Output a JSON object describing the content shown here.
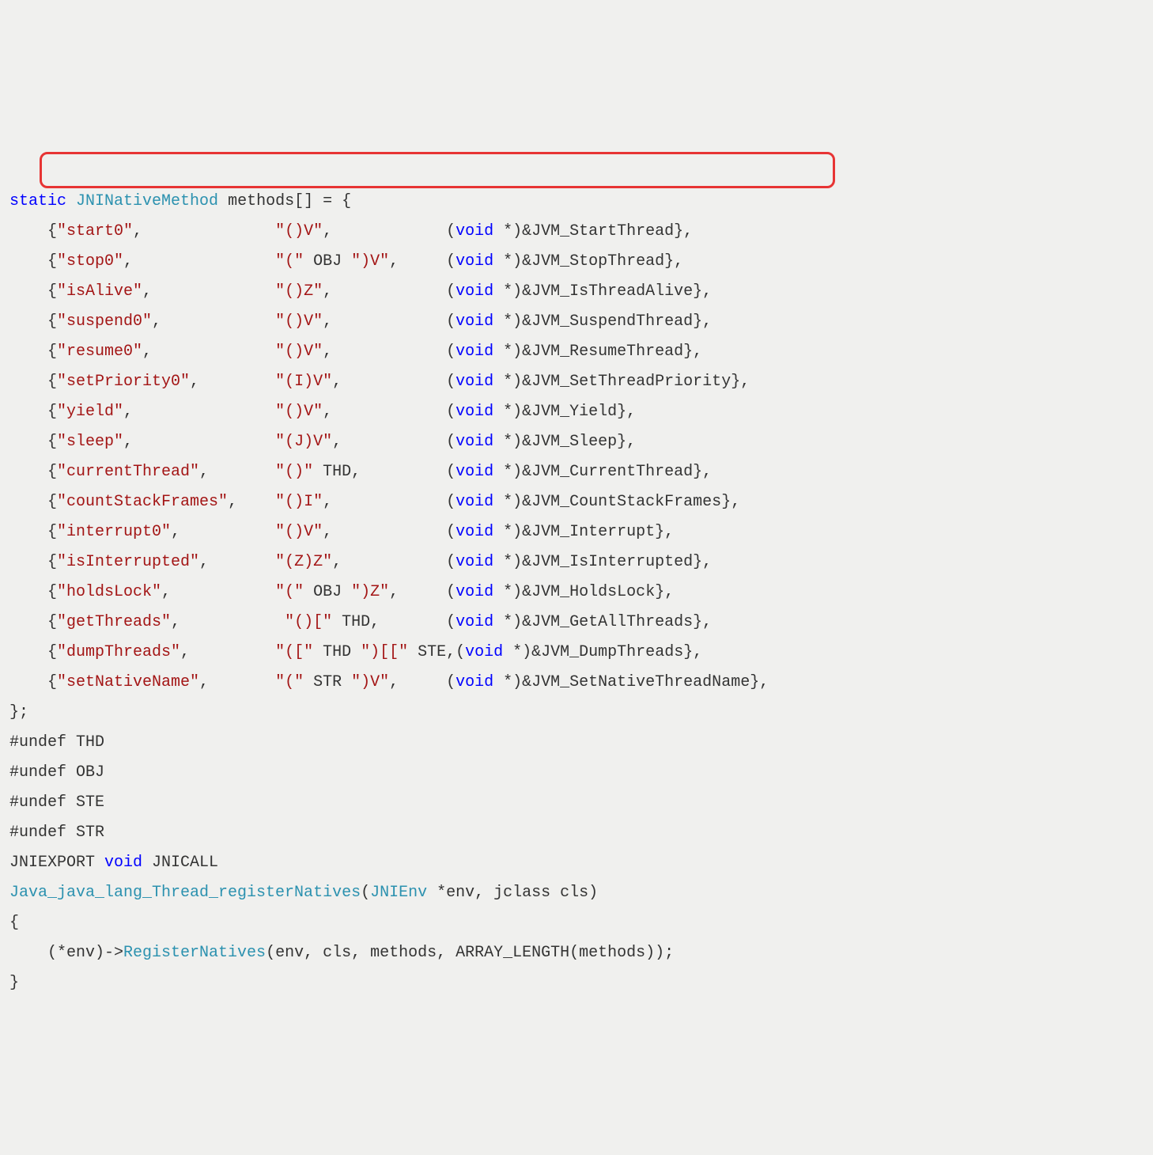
{
  "kw_static": "static",
  "type_JNINativeMethod": "JNINativeMethod",
  "ident_methods_decl": " methods[] = {",
  "methods": [
    {
      "name": "\"start0\"",
      "sig": "\"()V\"",
      "cast": "void",
      "fn": "&JVM_StartThread},"
    },
    {
      "name": "\"stop0\"",
      "sig": "\"(\" OBJ \")V\"",
      "cast": "void",
      "fn": "&JVM_StopThread},"
    },
    {
      "name": "\"isAlive\"",
      "sig": "\"()Z\"",
      "cast": "void",
      "fn": "&JVM_IsThreadAlive},"
    },
    {
      "name": "\"suspend0\"",
      "sig": "\"()V\"",
      "cast": "void",
      "fn": "&JVM_SuspendThread},"
    },
    {
      "name": "\"resume0\"",
      "sig": "\"()V\"",
      "cast": "void",
      "fn": "&JVM_ResumeThread},"
    },
    {
      "name": "\"setPriority0\"",
      "sig": "\"(I)V\"",
      "cast": "void",
      "fn": "&JVM_SetThreadPriority},"
    },
    {
      "name": "\"yield\"",
      "sig": "\"()V\"",
      "cast": "void",
      "fn": "&JVM_Yield},"
    },
    {
      "name": "\"sleep\"",
      "sig": "\"(J)V\"",
      "cast": "void",
      "fn": "&JVM_Sleep},"
    },
    {
      "name": "\"currentThread\"",
      "sig": "\"()\" THD",
      "cast": "void",
      "fn": "&JVM_CurrentThread},"
    },
    {
      "name": "\"countStackFrames\"",
      "sig": "\"()I\"",
      "cast": "void",
      "fn": "&JVM_CountStackFrames},"
    },
    {
      "name": "\"interrupt0\"",
      "sig": "\"()V\"",
      "cast": "void",
      "fn": "&JVM_Interrupt},"
    },
    {
      "name": "\"isInterrupted\"",
      "sig": "\"(Z)Z\"",
      "cast": "void",
      "fn": "&JVM_IsInterrupted},"
    },
    {
      "name": "\"holdsLock\"",
      "sig": "\"(\" OBJ \")Z\"",
      "cast": "void",
      "fn": "&JVM_HoldsLock},"
    },
    {
      "name": "\"getThreads\"",
      "sig": " \"()[\" THD",
      "cast": "void",
      "fn": "&JVM_GetAllThreads},"
    },
    {
      "name": "\"dumpThreads\"",
      "sig": "\"([\" THD \")[[\" STE",
      "cast": "void",
      "fn": "&JVM_DumpThreads},"
    },
    {
      "name": "\"setNativeName\"",
      "sig": "\"(\" STR \")V\"",
      "cast": "void",
      "fn": "&JVM_SetNativeThreadName},"
    }
  ],
  "col_name": 24,
  "col_sig": 18,
  "close_brace": "};",
  "undef1": "#undef THD",
  "undef2": "#undef OBJ",
  "undef3": "#undef STE",
  "undef4": "#undef STR",
  "export_line_pre": "JNIEXPORT ",
  "export_void": "void",
  "export_line_post": " JNICALL",
  "fn_decl_name": "Java_java_lang_Thread_registerNatives",
  "fn_decl_paren": "(",
  "fn_decl_type": "JNIEnv",
  "fn_decl_rest": " *env, jclass cls)",
  "open_b": "{",
  "body_indent": "    (*env)->",
  "body_fn": "RegisterNatives",
  "body_args": "(env, cls, methods, ARRAY_LENGTH(methods));",
  "close_b": "}"
}
